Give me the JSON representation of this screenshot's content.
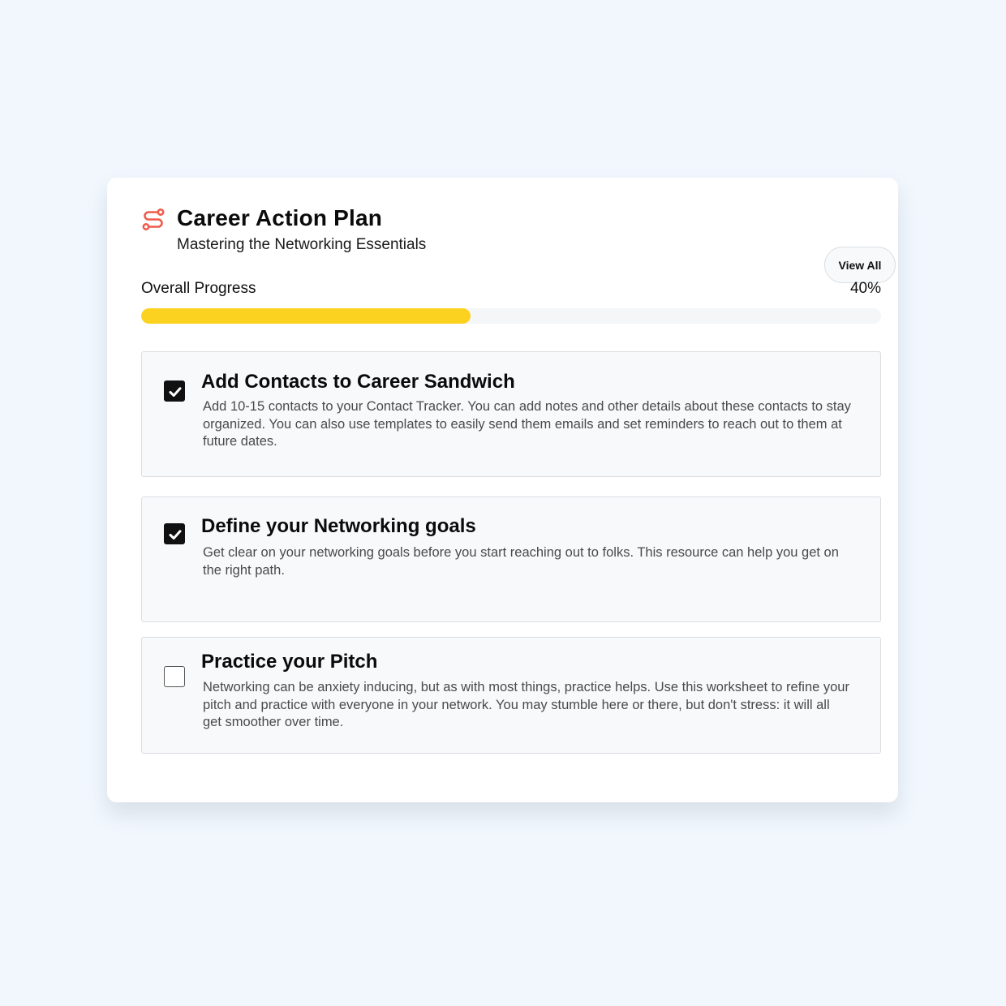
{
  "header": {
    "icon": "route-icon",
    "title": "Career Action Plan",
    "subtitle": "Mastering the Networking Essentials",
    "view_all_label": "View All"
  },
  "progress": {
    "label": "Overall Progress",
    "value_text": "40%",
    "fraction": 0.445
  },
  "tasks": [
    {
      "title": "Add Contacts to Career Sandwich",
      "description": "Add 10-15 contacts to your Contact Tracker. You can add notes and other details about these contacts to stay organized. You can also use templates to easily send them emails and set reminders to reach out to them at future dates.",
      "checked": true
    },
    {
      "title": "Define your Networking goals",
      "description": "Get clear on your networking goals before you start reaching out to folks. This resource can help you get on the right path.",
      "checked": true
    },
    {
      "title": "Practice your Pitch",
      "description": "Networking can be anxiety inducing, but as with most things, practice helps. Use this worksheet to refine your pitch and practice with everyone in your network. You may stumble here or there, but don't stress: it will all get smoother over time.",
      "checked": false
    }
  ],
  "colors": {
    "background": "#f1f7fd",
    "card": "#ffffff",
    "accent_icon": "#ef5b4a",
    "progress_fill": "#fcd220",
    "progress_track": "#f4f6f8",
    "task_background": "#f7f9fb",
    "checkbox_checked": "#111111"
  }
}
